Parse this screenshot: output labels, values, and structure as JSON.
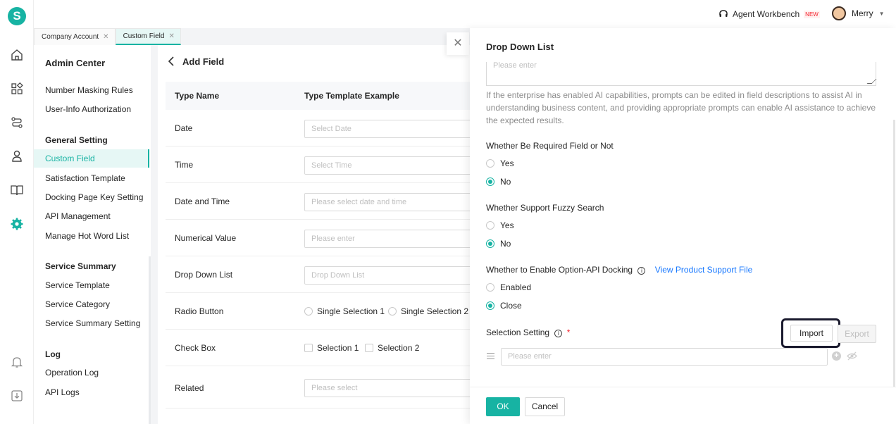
{
  "app": {
    "logo": "S",
    "brand_color": "#17b3a3"
  },
  "rail": {
    "icons": [
      "home-icon",
      "apps-icon",
      "flow-icon",
      "user-icon",
      "book-icon",
      "settings-icon",
      "bell-icon",
      "download-icon"
    ]
  },
  "topbar": {
    "agent_label": "Agent Workbench",
    "new_badge": "NEW",
    "user_name": "Merry"
  },
  "tabs": [
    {
      "label": "Company Account",
      "close": "✕"
    },
    {
      "label": "Custom Field",
      "close": "✕"
    }
  ],
  "sidebar": {
    "title": "Admin Center",
    "items_top": [
      "Number Masking Rules",
      "User-Info Authorization"
    ],
    "group1": "General Setting",
    "group1_items": [
      "Custom Field",
      "Satisfaction Template",
      "Docking Page Key Setting",
      "API Management",
      "Manage Hot Word List"
    ],
    "group2": "Service Summary",
    "group2_items": [
      "Service Template",
      "Service Category",
      "Service Summary Setting"
    ],
    "group3": "Log",
    "group3_items": [
      "Operation Log",
      "API Logs"
    ]
  },
  "main": {
    "title": "Add Field",
    "col_type_name": "Type Name",
    "col_example": "Type Template Example",
    "rows": [
      {
        "name": "Date",
        "placeholder": "Select Date"
      },
      {
        "name": "Time",
        "placeholder": "Select Time"
      },
      {
        "name": "Date and Time",
        "placeholder": "Please select date and time"
      },
      {
        "name": "Numerical Value",
        "placeholder": "Please enter"
      },
      {
        "name": "Drop Down List",
        "placeholder": "Drop Down List"
      },
      {
        "name": "Radio Button",
        "opt1": "Single Selection 1",
        "opt2": "Single Selection 2"
      },
      {
        "name": "Check Box",
        "opt1": "Selection 1",
        "opt2": "Selection 2"
      },
      {
        "name": "Related",
        "placeholder": "Please select"
      }
    ]
  },
  "drawer": {
    "close": "✕",
    "title": "Drop Down List",
    "textarea_placeholder": "Please enter",
    "description": "If the enterprise has enabled AI capabilities, prompts can be edited in field descriptions to assist AI in understanding business content, and providing appropriate prompts can enable AI assistance to achieve the expected results.",
    "required_label": "Whether Be Required Field or Not",
    "required_yes": "Yes",
    "required_no": "No",
    "fuzzy_label": "Whether Support Fuzzy Search",
    "fuzzy_yes": "Yes",
    "fuzzy_no": "No",
    "api_label": "Whether to Enable Option-API Docking",
    "api_link": "View Product Support File",
    "api_enabled": "Enabled",
    "api_close": "Close",
    "selection_label": "Selection Setting",
    "required_mark": "*",
    "info_glyph": "i",
    "import": "Import",
    "export": "Export",
    "option_placeholder": "Please enter",
    "plus": "+",
    "ok": "OK",
    "cancel": "Cancel"
  }
}
